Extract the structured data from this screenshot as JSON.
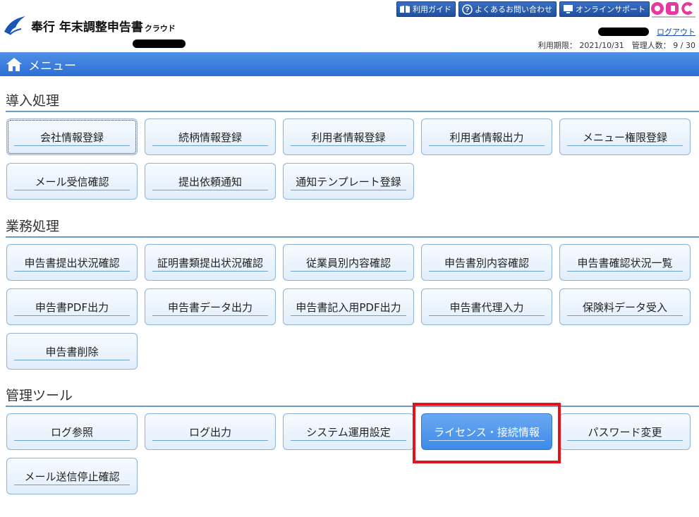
{
  "header": {
    "app_name": "奉行 年末調整申告書",
    "app_suffix": "クラウド",
    "links": [
      {
        "label": "利用ガイド",
        "icon": "book-icon"
      },
      {
        "label": "よくあるお問い合わせ",
        "icon": "question-icon"
      },
      {
        "label": "オンラインサポート",
        "icon": "monitor-icon"
      }
    ],
    "brand": "OBC",
    "logout_label": "ログアウト",
    "status": "利用期限： 2021/10/31　管理人数： 9 / 30"
  },
  "menubar": {
    "title": "メニュー",
    "icon": "home-icon"
  },
  "sections": [
    {
      "title": "導入処理",
      "buttons": [
        "会社情報登録",
        "続柄情報登録",
        "利用者情報登録",
        "利用者情報出力",
        "メニュー権限登録",
        "メール受信確認",
        "提出依頼通知",
        "通知テンプレート登録"
      ]
    },
    {
      "title": "業務処理",
      "buttons": [
        "申告書提出状況確認",
        "証明書類提出状況確認",
        "従業員別内容確認",
        "申告書別内容確認",
        "申告書確認状況一覧",
        "申告書PDF出力",
        "申告書データ出力",
        "申告書記入用PDF出力",
        "申告書代理入力",
        "保険料データ受入",
        "申告書削除"
      ]
    },
    {
      "title": "管理ツール",
      "buttons": [
        "ログ参照",
        "ログ出力",
        "システム運用設定",
        "ライセンス・接続情報",
        "パスワード変更",
        "メール送信停止確認"
      ]
    }
  ],
  "colors": {
    "menubar": "#3a7de0",
    "highlight": "#e2141b",
    "active_button": "#4a93ec"
  }
}
